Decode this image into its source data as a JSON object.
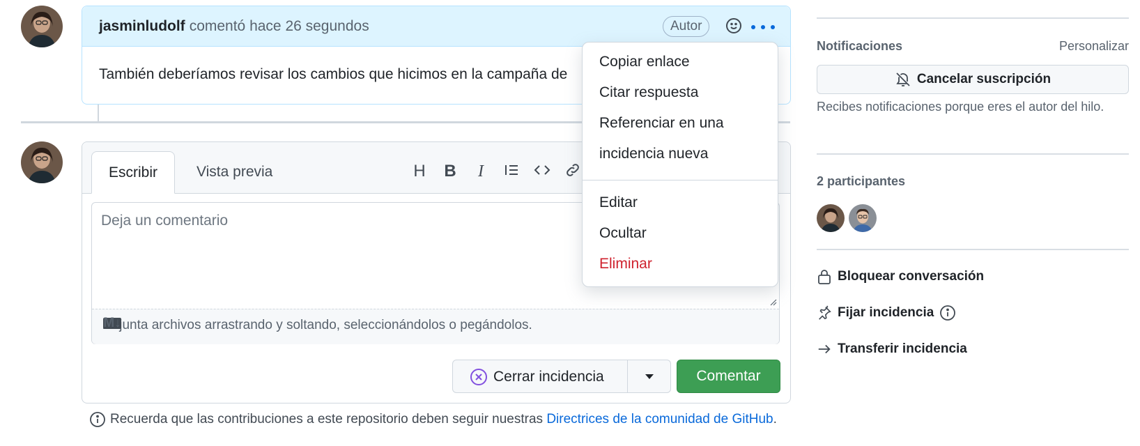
{
  "comment": {
    "author": "jasminludolf",
    "meta": "comentó hace 26 segundos",
    "badge": "Autor",
    "body": "También deberíamos revisar los cambios que hicimos en la campaña de"
  },
  "menu": {
    "items": [
      "Copiar enlace",
      "Citar respuesta",
      "Referenciar en una",
      "incidencia nueva",
      "Editar",
      "Ocultar",
      "Eliminar"
    ]
  },
  "editor": {
    "tabs": {
      "write": "Escribir",
      "preview": "Vista previa"
    },
    "toolbar": {
      "heading": "H",
      "bold": "B",
      "italic": "I"
    },
    "placeholder": "Deja un comentario",
    "attach_hint": "Adjunta archivos arrastrando y soltando, seleccionándolos o pegándolos.",
    "markdown_badge": "M↓",
    "close_button": "Cerrar incidencia",
    "comment_button": "Comentar"
  },
  "notice": {
    "text": "Recuerda que las contribuciones a este repositorio deben seguir nuestras",
    "link": "Directrices de la comunidad de GitHub",
    "end": "."
  },
  "sidebar": {
    "notifications_title": "Notificaciones",
    "customize": "Personalizar",
    "unsubscribe": "Cancelar suscripción",
    "notifications_note": "Recibes notificaciones porque eres el autor del hilo.",
    "participants_title": "2 participantes",
    "lock": "Bloquear conversación",
    "pin": "Fijar incidencia",
    "transfer": "Transferir incidencia"
  },
  "colors": {
    "accent": "#0969da",
    "success": "#3d9e54",
    "danger": "#cf222e",
    "comment_header": "#ddf4ff"
  }
}
